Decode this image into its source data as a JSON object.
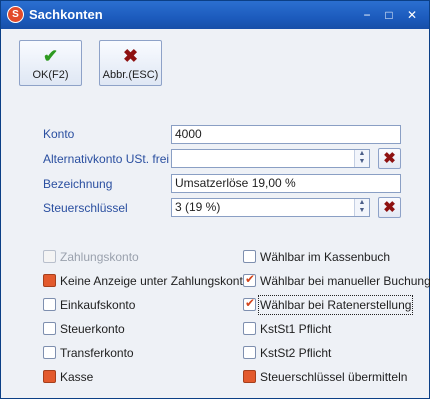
{
  "window": {
    "title": "Sachkonten",
    "icon": "app-logo-icon"
  },
  "toolbar": {
    "ok_label": "OK(F2)",
    "cancel_label": "Abbr.(ESC)"
  },
  "form": {
    "konto_label": "Konto",
    "konto_value": "4000",
    "alt_label": "Alternativkonto  USt. frei",
    "alt_value": "",
    "bez_label": "Bezeichnung",
    "bez_value": "Umsatzerlöse 19,00 %",
    "steuer_label": "Steuerschlüssel",
    "steuer_value": "3 (19 %)"
  },
  "checkboxes_left": [
    {
      "label": "Zahlungskonto",
      "state": "disabled"
    },
    {
      "label": "Keine Anzeige unter Zahlungskonten",
      "state": "filled"
    },
    {
      "label": "Einkaufskonto",
      "state": "empty"
    },
    {
      "label": "Steuerkonto",
      "state": "empty"
    },
    {
      "label": "Transferkonto",
      "state": "empty"
    },
    {
      "label": "Kasse",
      "state": "filled"
    }
  ],
  "checkboxes_right": [
    {
      "label": "Wählbar im Kassenbuch",
      "state": "empty"
    },
    {
      "label": "Wählbar bei manueller Buchung",
      "state": "checked"
    },
    {
      "label": "Wählbar bei Ratenerstellung",
      "state": "checked"
    },
    {
      "label": "KstSt1 Pflicht",
      "state": "empty"
    },
    {
      "label": "KstSt2 Pflicht",
      "state": "empty"
    },
    {
      "label": "Steuerschlüssel übermitteln",
      "state": "filled"
    }
  ],
  "colors": {
    "titlebar": "#1c5bbd",
    "accent_orange": "#e35a2d",
    "label_blue": "#2a4fa0",
    "ok_green": "#2e9a21",
    "cancel_red": "#8e1111"
  }
}
